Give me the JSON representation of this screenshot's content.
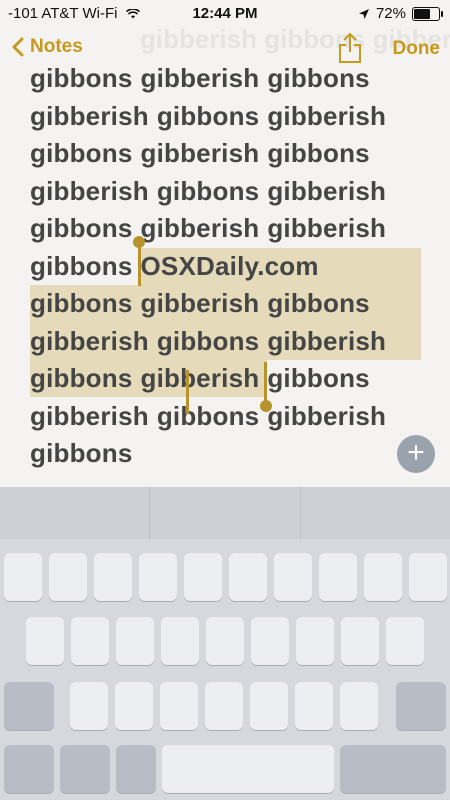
{
  "status_bar": {
    "carrier": "-101 AT&T Wi-Fi",
    "time": "12:44 PM",
    "battery_percent": "72%",
    "battery_level": 0.72,
    "location_icon": "location-arrow-icon"
  },
  "nav": {
    "back_label": "Notes",
    "done_label": "Done",
    "share_icon": "share-icon",
    "accent_color": "#c69a1c"
  },
  "note": {
    "ghost_text": "gibberish gibbons gibberish",
    "lines": [
      [
        "gibbons",
        "gibberish",
        "gibbons"
      ],
      [
        "gibberish",
        "gibbons",
        "gibberish"
      ],
      [
        "gibbons",
        "gibberish",
        "gibbons"
      ],
      [
        "gibberish",
        "gibbons",
        "gibberish"
      ],
      [
        "gibbons",
        "gibberish",
        "gibberish"
      ],
      [
        "gibbons",
        "OSXDaily.com"
      ],
      [
        "gibbons",
        "gibberish",
        "gibbons"
      ],
      [
        "gibberish",
        "gibbons",
        "gibberish"
      ],
      [
        "gibbons",
        "gibberish",
        "gibbons"
      ],
      [
        "gibberish",
        "gibbons",
        "gibberish"
      ],
      [
        "gibbons"
      ]
    ],
    "selection_color": "#d2be78"
  },
  "add_button": {
    "icon": "plus-icon",
    "label": "+"
  }
}
